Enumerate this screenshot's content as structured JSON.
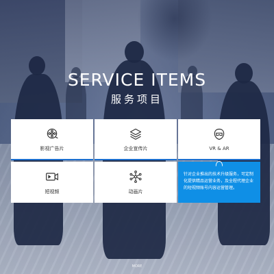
{
  "header": {
    "title": "SERVICE ITEMS",
    "subtitle": "服务项目"
  },
  "services": [
    {
      "label": "影视广告片",
      "icon": "film-reel-icon"
    },
    {
      "label": "企业宣传片",
      "icon": "layers-icon"
    },
    {
      "label": "VR & AR",
      "icon": "vr-headset-icon"
    },
    {
      "label": "短视频",
      "icon": "video-camera-icon"
    },
    {
      "label": "动画片",
      "icon": "network-nodes-icon"
    }
  ],
  "highlight_card": {
    "description": "针对企业推出的技术升级服务，可定制化提供精品运营业务，及全程代理企业的短视频账号内容运营管理。",
    "icon": "vr-headset-icon"
  },
  "footer": {
    "mark": "MORE"
  },
  "colors": {
    "accent": "#1b6fcf",
    "highlight_bg": "#0f8fe6",
    "card_bg": "#ffffff",
    "text": "#333333"
  }
}
